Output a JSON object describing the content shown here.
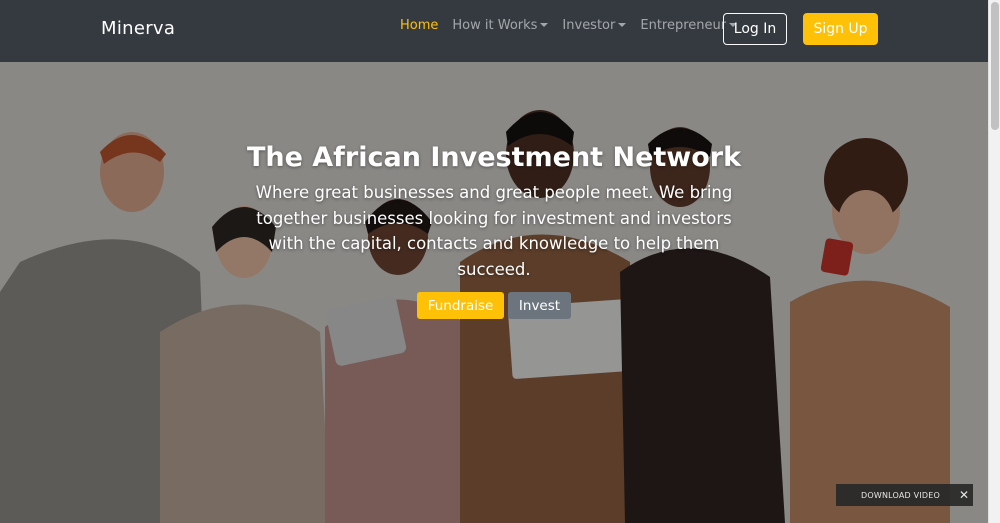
{
  "navbar": {
    "brand": "Minerva",
    "links": [
      {
        "label": "Home",
        "active": true,
        "dropdown": false
      },
      {
        "label": "How it Works",
        "active": false,
        "dropdown": true
      },
      {
        "label": "Investor",
        "active": false,
        "dropdown": true
      },
      {
        "label": "Entrepreneur",
        "active": false,
        "dropdown": true
      }
    ],
    "login_label": "Log In",
    "signup_label": "Sign Up"
  },
  "hero": {
    "title": "The African Investment Network",
    "subtitle": "Where great businesses and great people meet. We bring together businesses looking for investment and investors with the capital, contacts and knowledge to help them succeed.",
    "fundraise_label": "Fundraise",
    "invest_label": "Invest"
  },
  "video_bar": {
    "label": "DOWNLOAD VIDEO",
    "close_icon": "close-icon"
  },
  "colors": {
    "navbar_bg": "#343a40",
    "accent": "#ffc107",
    "secondary": "#6c757d"
  }
}
